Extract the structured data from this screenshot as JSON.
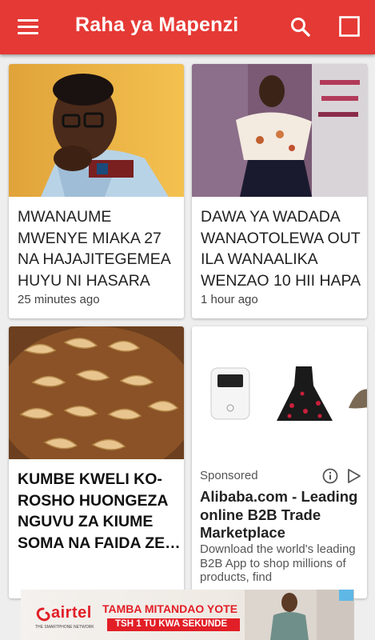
{
  "app": {
    "title": "Raha ya Mapenzi"
  },
  "articles": [
    {
      "headline": "MWANAUME MWENYE MIAKA 27 NA HAJAJITEGEMEA HUYU NI HASARA",
      "time": "25 minutes ago"
    },
    {
      "headline": "DAWA YA WADADA WANAOTOLEWA OUT ILA WANAALIKA WENZAO 10 HII HAPA",
      "time": "1 hour ago"
    },
    {
      "headline": "KUMBE KWELI KO-ROSHO HUONGEZA NGUVU ZA KIUME SOMA NA FAIDA ZE…"
    }
  ],
  "ad": {
    "sponsored": "Sponsored",
    "title": "Alibaba.com - Leading online B2B Trade Marketplace",
    "description": "Download the world's leading B2B App to shop millions of products, find"
  },
  "banner": {
    "brand": "airtel",
    "tagline": "THE SMARTPHONE NETWORK",
    "headline": "TAMBA MITANDAO YOTE",
    "subline": "TSH 1 TU KWA SEKUNDE"
  },
  "colors": {
    "appbar": "#e53935",
    "banner_red": "#e21e26"
  }
}
